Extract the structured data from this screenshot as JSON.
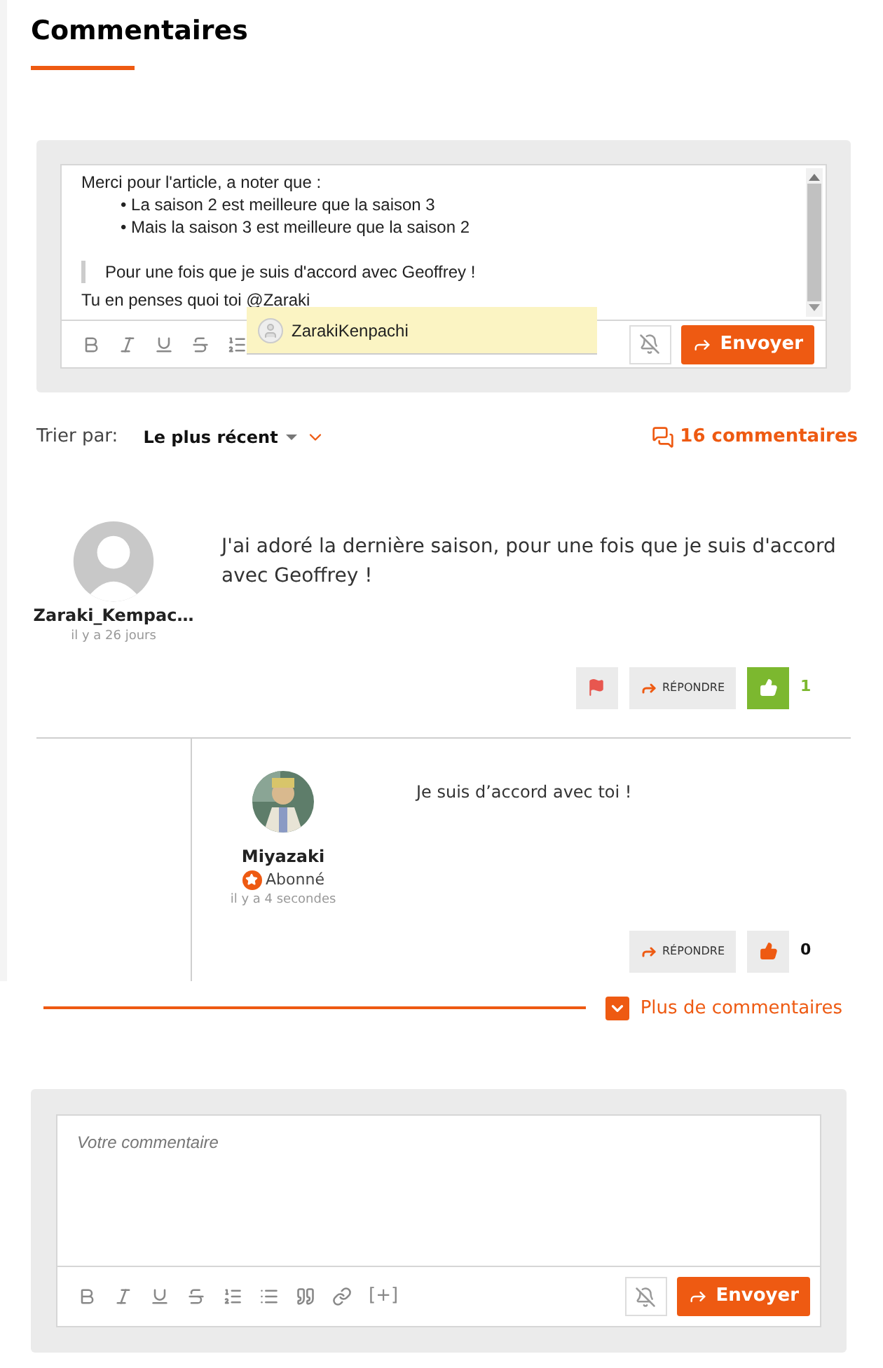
{
  "title": "Commentaires",
  "editor": {
    "lines": [
      {
        "kind": "text",
        "text": "Merci pour l'article, a noter que :"
      },
      {
        "kind": "bullet",
        "marker": "•",
        "text": "La saison 2 est meilleure que la saison 3"
      },
      {
        "kind": "bullet",
        "marker": "•",
        "text": "Mais la saison 3 est meilleure que la saison 2"
      },
      {
        "kind": "quote",
        "text": "Pour une fois que je suis d'accord avec Geoffrey !"
      },
      {
        "kind": "text",
        "text": "Tu en penses quoi toi @Zaraki"
      }
    ],
    "mention": {
      "name": "ZarakiKenpachi"
    },
    "muted": true,
    "send_label": "Envoyer"
  },
  "sort": {
    "label": "Trier par:",
    "value": "Le plus récent"
  },
  "count": "16 commentaires",
  "comments": [
    {
      "author": "Zaraki_Kempac…",
      "avatar": {
        "kind": "silhouette"
      },
      "time": "il y a 26 jours",
      "text": "J'ai adoré la dernière saison, pour une fois que je suis d'accord avec Geoffrey !",
      "reply_label": "RÉPONDRE",
      "liked": true,
      "likes": "1",
      "children": [
        {
          "author": "Miyazaki",
          "badge": "Abonné",
          "time": "il y a 4 secondes",
          "text": "Je suis d’accord avec toi !",
          "reply_label": "RÉPONDRE",
          "liked": false,
          "likes": "0"
        }
      ]
    }
  ],
  "more": "Plus de commentaires",
  "composer": {
    "placeholder": "Votre commentaire",
    "extra": "[+]",
    "muted": true,
    "send_label": "Envoyer"
  }
}
